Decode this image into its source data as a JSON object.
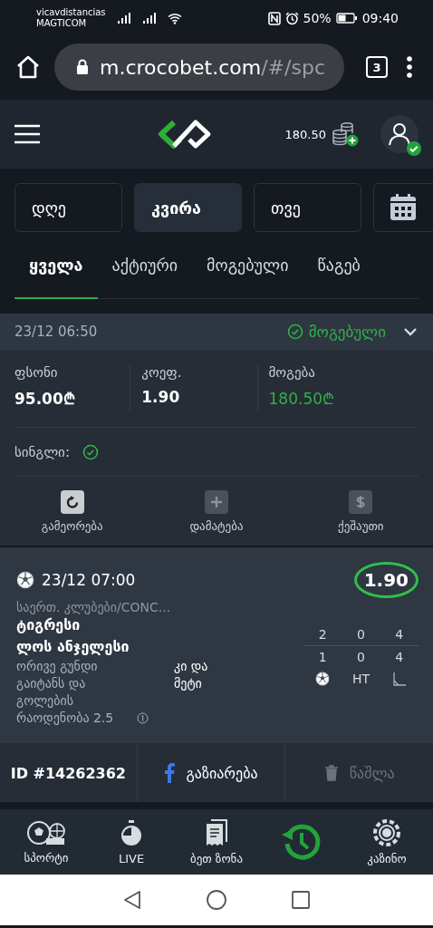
{
  "status_bar": {
    "carrier_1": "vicavdistancias",
    "carrier_2": "MAGTICOM",
    "battery": "50%",
    "time": "09:40"
  },
  "browser": {
    "url_host": "m.crocobet.com",
    "url_path": "/#/spc",
    "tab_count": "3"
  },
  "header": {
    "balance": "180.50"
  },
  "periods": [
    {
      "label": "დღე",
      "selected": false
    },
    {
      "label": "კვირა",
      "selected": true
    },
    {
      "label": "თვე",
      "selected": false
    }
  ],
  "tabs": [
    {
      "label": "ყველა",
      "selected": true
    },
    {
      "label": "აქტიური",
      "selected": false
    },
    {
      "label": "მოგებული",
      "selected": false
    },
    {
      "label": "წაგებ",
      "selected": false
    }
  ],
  "bet": {
    "date": "23/12 06:50",
    "status": "მოგებული",
    "expanded": false,
    "stats": [
      {
        "label": "ფსონი",
        "value": "95.00₾",
        "kind": "plain"
      },
      {
        "label": "კოეფ.",
        "value": "1.90",
        "kind": "plain"
      },
      {
        "label": "მოგება",
        "value": "180.50₾",
        "kind": "win"
      }
    ],
    "type_label": "სინგლი:",
    "actions": [
      {
        "label": "გამეორება",
        "kind": "repeat",
        "disabled": false
      },
      {
        "label": "დამატება",
        "kind": "add",
        "disabled": true
      },
      {
        "label": "ქეშაუთი",
        "kind": "cashout",
        "disabled": true
      }
    ]
  },
  "event": {
    "date": "23/12 07:00",
    "odds": "1.90",
    "league": "საერთ. კლუბები/CONC...",
    "team_1": "ტიგრესი",
    "team_2": "ლოს ანჯელესი",
    "market": "ორივე გუნდი გაიტანს და გოლების რაოდენობა 2.5",
    "pick": "კი და მეტი",
    "scores": [
      [
        "2",
        "0",
        "4"
      ],
      [
        "1",
        "0",
        "4"
      ]
    ],
    "score_headers": [
      {
        "kind": "goals"
      },
      {
        "kind": "text",
        "label": "HT"
      },
      {
        "kind": "corners"
      }
    ]
  },
  "footer": {
    "id": "ID #14262362",
    "share": "გაზიარება",
    "delete": {
      "label": "წაშლა",
      "disabled": true
    }
  },
  "nav": [
    {
      "label": "სპორტი",
      "kind": "sports",
      "selected": false
    },
    {
      "label": "LIVE",
      "kind": "live",
      "selected": false
    },
    {
      "label": "ბეთ ზონა",
      "kind": "betzone",
      "selected": false
    },
    {
      "kind": "history",
      "selected": true
    },
    {
      "label": "კაზინო",
      "kind": "casino",
      "selected": false
    }
  ]
}
